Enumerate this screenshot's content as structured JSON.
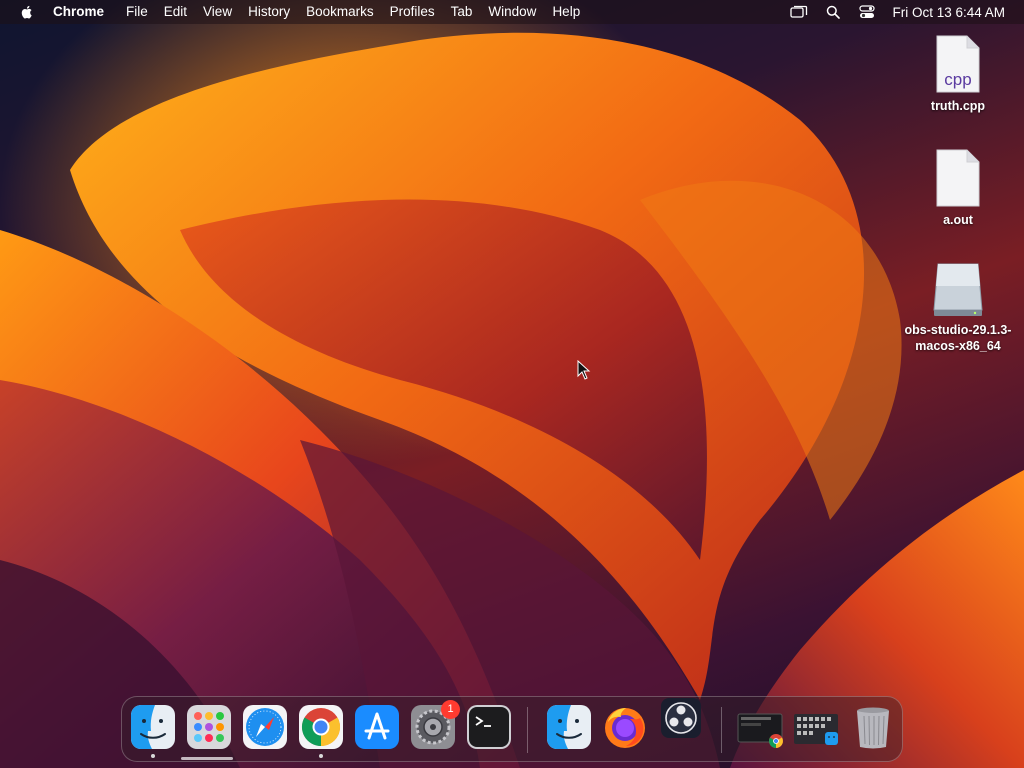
{
  "menubar": {
    "app_name": "Chrome",
    "items": [
      "File",
      "Edit",
      "View",
      "History",
      "Bookmarks",
      "Profiles",
      "Tab",
      "Window",
      "Help"
    ],
    "clock": "Fri Oct 13  6:44 AM",
    "status_icons": [
      "screen-mirroring-icon",
      "spotlight-search-icon",
      "control-center-icon"
    ]
  },
  "desktop": {
    "icons": [
      {
        "label": "truth.cpp",
        "glyph_text": "cpp",
        "type": "cpp-file"
      },
      {
        "label": "a.out",
        "type": "blank-file"
      },
      {
        "label": "obs-studio-29.1.3-macos-x86_64",
        "type": "disk-image"
      }
    ]
  },
  "dock": {
    "apps": [
      {
        "name": "Finder",
        "icon": "finder-icon",
        "running": true
      },
      {
        "name": "Launchpad",
        "icon": "launchpad-icon",
        "running": false
      },
      {
        "name": "Safari",
        "icon": "safari-icon",
        "running": false
      },
      {
        "name": "Google Chrome",
        "icon": "chrome-icon",
        "running": true
      },
      {
        "name": "App Store",
        "icon": "app-store-icon",
        "running": false
      },
      {
        "name": "System Settings",
        "icon": "system-settings-icon",
        "running": false,
        "badge": "1"
      },
      {
        "name": "Terminal",
        "icon": "terminal-icon",
        "running": false
      }
    ],
    "recent": [
      {
        "name": "Finder",
        "icon": "finder-icon"
      },
      {
        "name": "Firefox",
        "icon": "firefox-icon"
      },
      {
        "name": "OBS Studio",
        "icon": "obs-icon"
      }
    ],
    "stacks": [
      {
        "name": "Downloads stack",
        "icon": "downloads-stack-icon"
      },
      {
        "name": "Applications stack",
        "icon": "applications-stack-icon"
      },
      {
        "name": "Trash",
        "icon": "trash-icon"
      }
    ]
  },
  "colors": {
    "badge": "#ff3b30",
    "wallpaper_orange": "#f08a1a",
    "wallpaper_red": "#c0281e",
    "wallpaper_purple": "#6a1a48"
  }
}
